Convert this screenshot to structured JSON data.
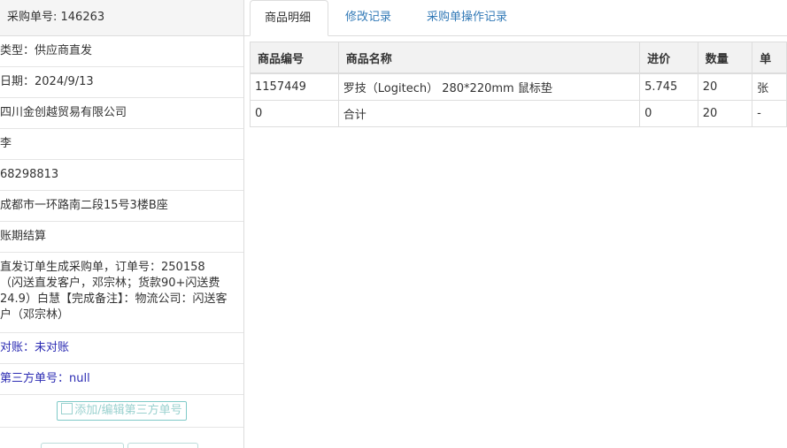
{
  "left": {
    "header": "采购单号: 146263",
    "rows": [
      "类型：供应商直发",
      "日期：2024/9/13",
      "四川金创越贸易有限公司",
      "李",
      "68298813",
      "成都市一环路南二段15号3楼B座",
      "账期结算",
      "直发订单生成采购单，订单号：250158（闪送直发客户，邓宗林；货款90+闪送费24.9）白慧【完成备注】：物流公司：闪送客户（邓宗林）"
    ],
    "reconcile": "对账：未对账",
    "third_party_no": "第三方单号：null",
    "add_edit_button": "添加/编辑第三方单号",
    "colors": {
      "link_blue": "#2b2bb3",
      "button_teal": "#7fcac8"
    }
  },
  "tabs": [
    {
      "label": "商品明细",
      "active": true
    },
    {
      "label": "修改记录",
      "active": false
    },
    {
      "label": "采购单操作记录",
      "active": false
    }
  ],
  "table": {
    "headers": [
      "商品编号",
      "商品名称",
      "进价",
      "数量",
      "单"
    ],
    "rows": [
      [
        "1157449",
        "罗技（Logitech） 280*220mm 鼠标垫",
        "5.745",
        "20",
        "张"
      ],
      [
        "0",
        "合计",
        "0",
        "20",
        "-"
      ]
    ]
  },
  "icons": {
    "edit": "edit-icon"
  }
}
